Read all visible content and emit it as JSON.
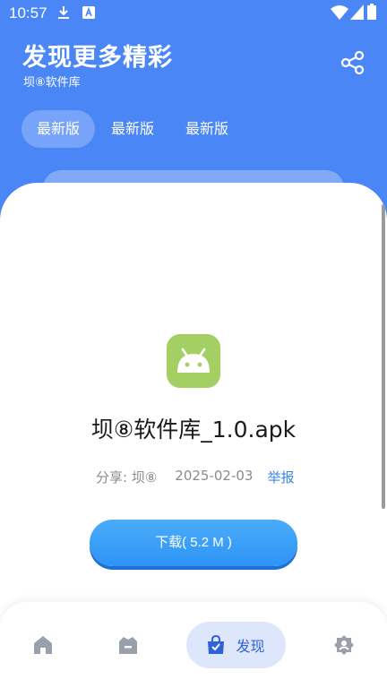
{
  "status_bar": {
    "time": "10:57"
  },
  "header": {
    "title": "发现更多精彩",
    "subtitle": "坝⑧软件库"
  },
  "tabs": [
    {
      "label": "最新版",
      "active": true
    },
    {
      "label": "最新版",
      "active": false
    },
    {
      "label": "最新版",
      "active": false
    }
  ],
  "app": {
    "icon": "android-icon",
    "name": "坝⑧软件库_1.0.apk",
    "share_label": "分享: 坝⑧",
    "date": "2025-02-03",
    "report_label": "举报",
    "download_label": "下载( 5.2 M )"
  },
  "bottom_nav": {
    "discover_label": "发现"
  },
  "colors": {
    "header_bg": "#4a86f6",
    "accent": "#2e94f5",
    "android_green": "#a4cf63",
    "report_link": "#3a86e8"
  }
}
